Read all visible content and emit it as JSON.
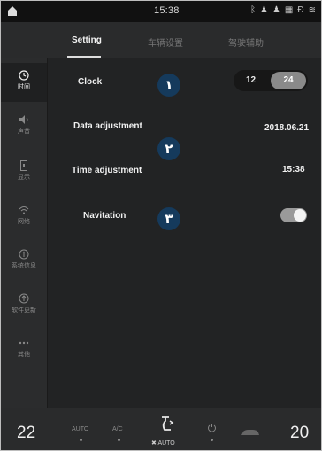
{
  "status": {
    "time": "15:38",
    "icons": [
      "bluetooth-icon",
      "person-icon",
      "person-icon",
      "grid-icon",
      "d-icon",
      "wifi-icon"
    ]
  },
  "tabs": [
    {
      "label": "Setting",
      "active": true
    },
    {
      "label": "车辆设置",
      "active": false
    },
    {
      "label": "驾驶辅助",
      "active": false
    }
  ],
  "sidebar": [
    {
      "label": "时间",
      "icon": "clock-icon",
      "active": true
    },
    {
      "label": "声音",
      "icon": "speaker-icon",
      "active": false
    },
    {
      "label": "显示",
      "icon": "display-icon",
      "active": false
    },
    {
      "label": "网络",
      "icon": "wifi-icon",
      "active": false
    },
    {
      "label": "系统信息",
      "icon": "info-icon",
      "active": false
    },
    {
      "label": "软件更新",
      "icon": "update-icon",
      "active": false
    },
    {
      "label": "其他",
      "icon": "more-icon",
      "active": false
    }
  ],
  "settings": {
    "clock_label": "Clock",
    "clock_opt_12": "12",
    "clock_opt_24": "24",
    "clock_selected": "24",
    "date_label": "Data adjustment",
    "date_value": "2018.06.21",
    "time_label": "Time adjustment",
    "time_value": "15:38",
    "nav_label": "Navitation",
    "nav_toggle_on": true
  },
  "badges": {
    "one": "١",
    "two": "٢",
    "three": "٣"
  },
  "bottom": {
    "temp_left": "22",
    "temp_right": "20",
    "auto_label": "AUTO",
    "ac_label": "A/C",
    "fan_label": "AUTO"
  },
  "colors": {
    "badge": "#153a5c",
    "background": "#222324",
    "toggle_on": "#9a9a9a"
  }
}
